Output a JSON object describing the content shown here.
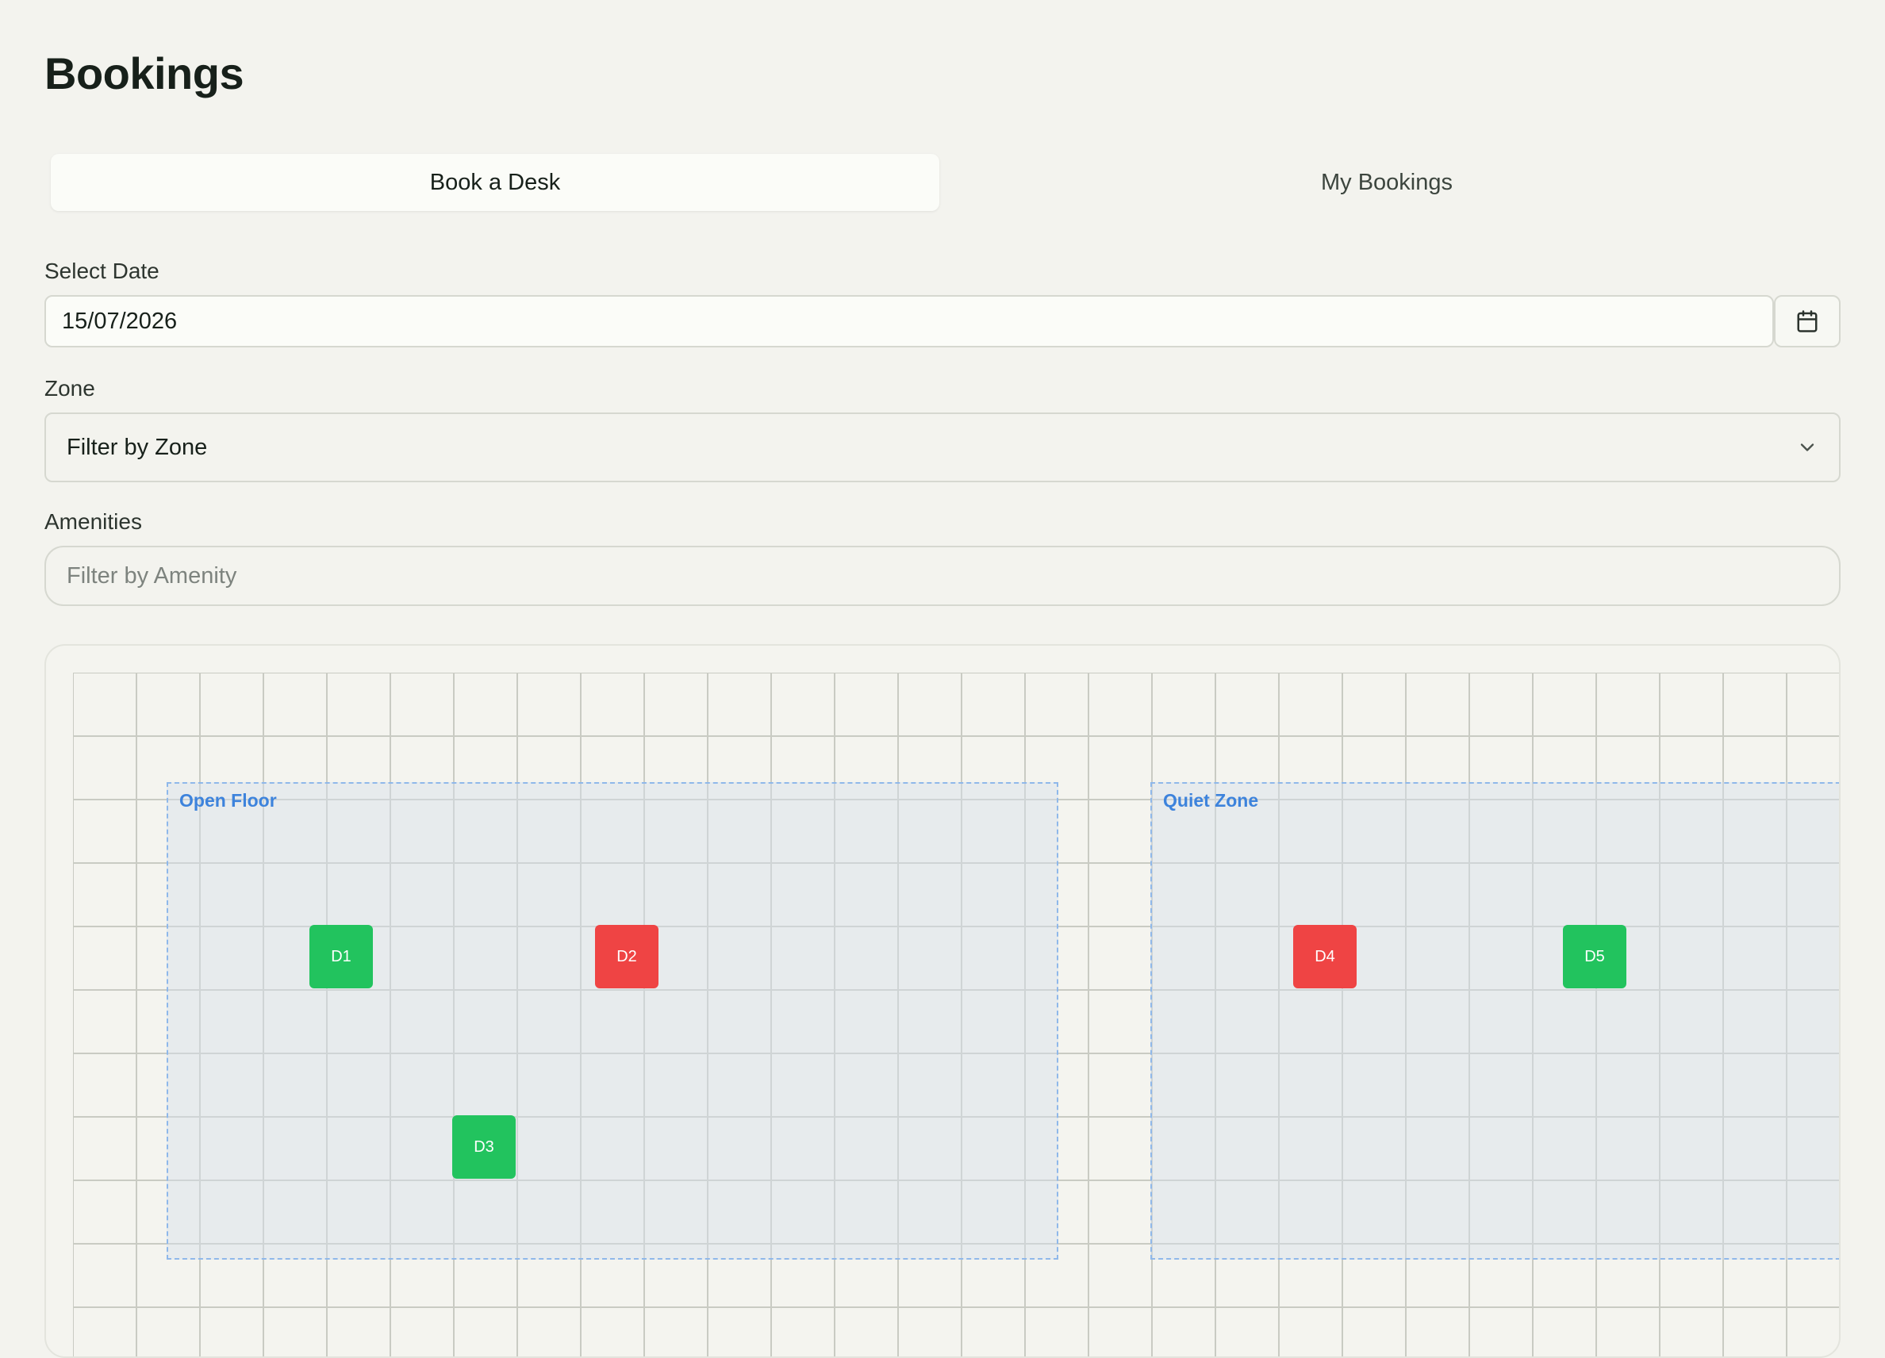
{
  "page": {
    "title": "Bookings"
  },
  "tabs": [
    {
      "label": "Book a Desk",
      "active": true
    },
    {
      "label": "My Bookings",
      "active": false
    }
  ],
  "date": {
    "label": "Select Date",
    "value": "15/07/2026",
    "calendar_icon": "calendar-icon"
  },
  "zone": {
    "label": "Zone",
    "placeholder": "Filter by Zone",
    "chevron_icon": "chevron-down-icon"
  },
  "amenities": {
    "label": "Amenities",
    "placeholder": "Filter by Amenity"
  },
  "floor_map": {
    "zones": [
      {
        "name": "Open Floor"
      },
      {
        "name": "Quiet Zone"
      }
    ],
    "desks": [
      {
        "label": "D1",
        "zone": "Open Floor",
        "status": "available"
      },
      {
        "label": "D2",
        "zone": "Open Floor",
        "status": "booked"
      },
      {
        "label": "D3",
        "zone": "Open Floor",
        "status": "available"
      },
      {
        "label": "D4",
        "zone": "Quiet Zone",
        "status": "booked"
      },
      {
        "label": "D5",
        "zone": "Quiet Zone",
        "status": "available"
      }
    ],
    "colors": {
      "available": "#22c35e",
      "booked": "#ef4444",
      "zone_border": "#8fb8ea",
      "zone_label": "#3d83dc"
    }
  }
}
